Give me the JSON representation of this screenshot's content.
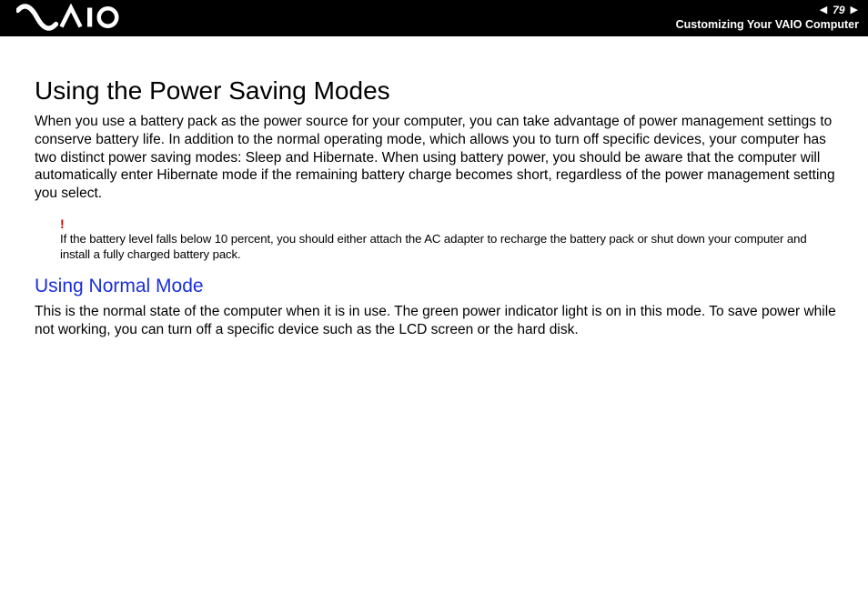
{
  "header": {
    "page_number": "79",
    "breadcrumb": "Customizing Your VAIO Computer"
  },
  "content": {
    "title": "Using the Power Saving Modes",
    "intro": "When you use a battery pack as the power source for your computer, you can take advantage of power management settings to conserve battery life. In addition to the normal operating mode, which allows you to turn off specific devices, your computer has two distinct power saving modes: Sleep and Hibernate. When using battery power, you should be aware that the computer will automatically enter Hibernate mode if the remaining battery charge becomes short, regardless of the power management setting you select.",
    "note_marker": "!",
    "note": "If the battery level falls below 10 percent, you should either attach the AC adapter to recharge the battery pack or shut down your computer and install a fully charged battery pack.",
    "normal_heading": "Using Normal Mode",
    "normal_body": "This is the normal state of the computer when it is in use. The green power indicator light is on in this mode. To save power while not working, you can turn off a specific device such as the LCD screen or the hard disk."
  }
}
